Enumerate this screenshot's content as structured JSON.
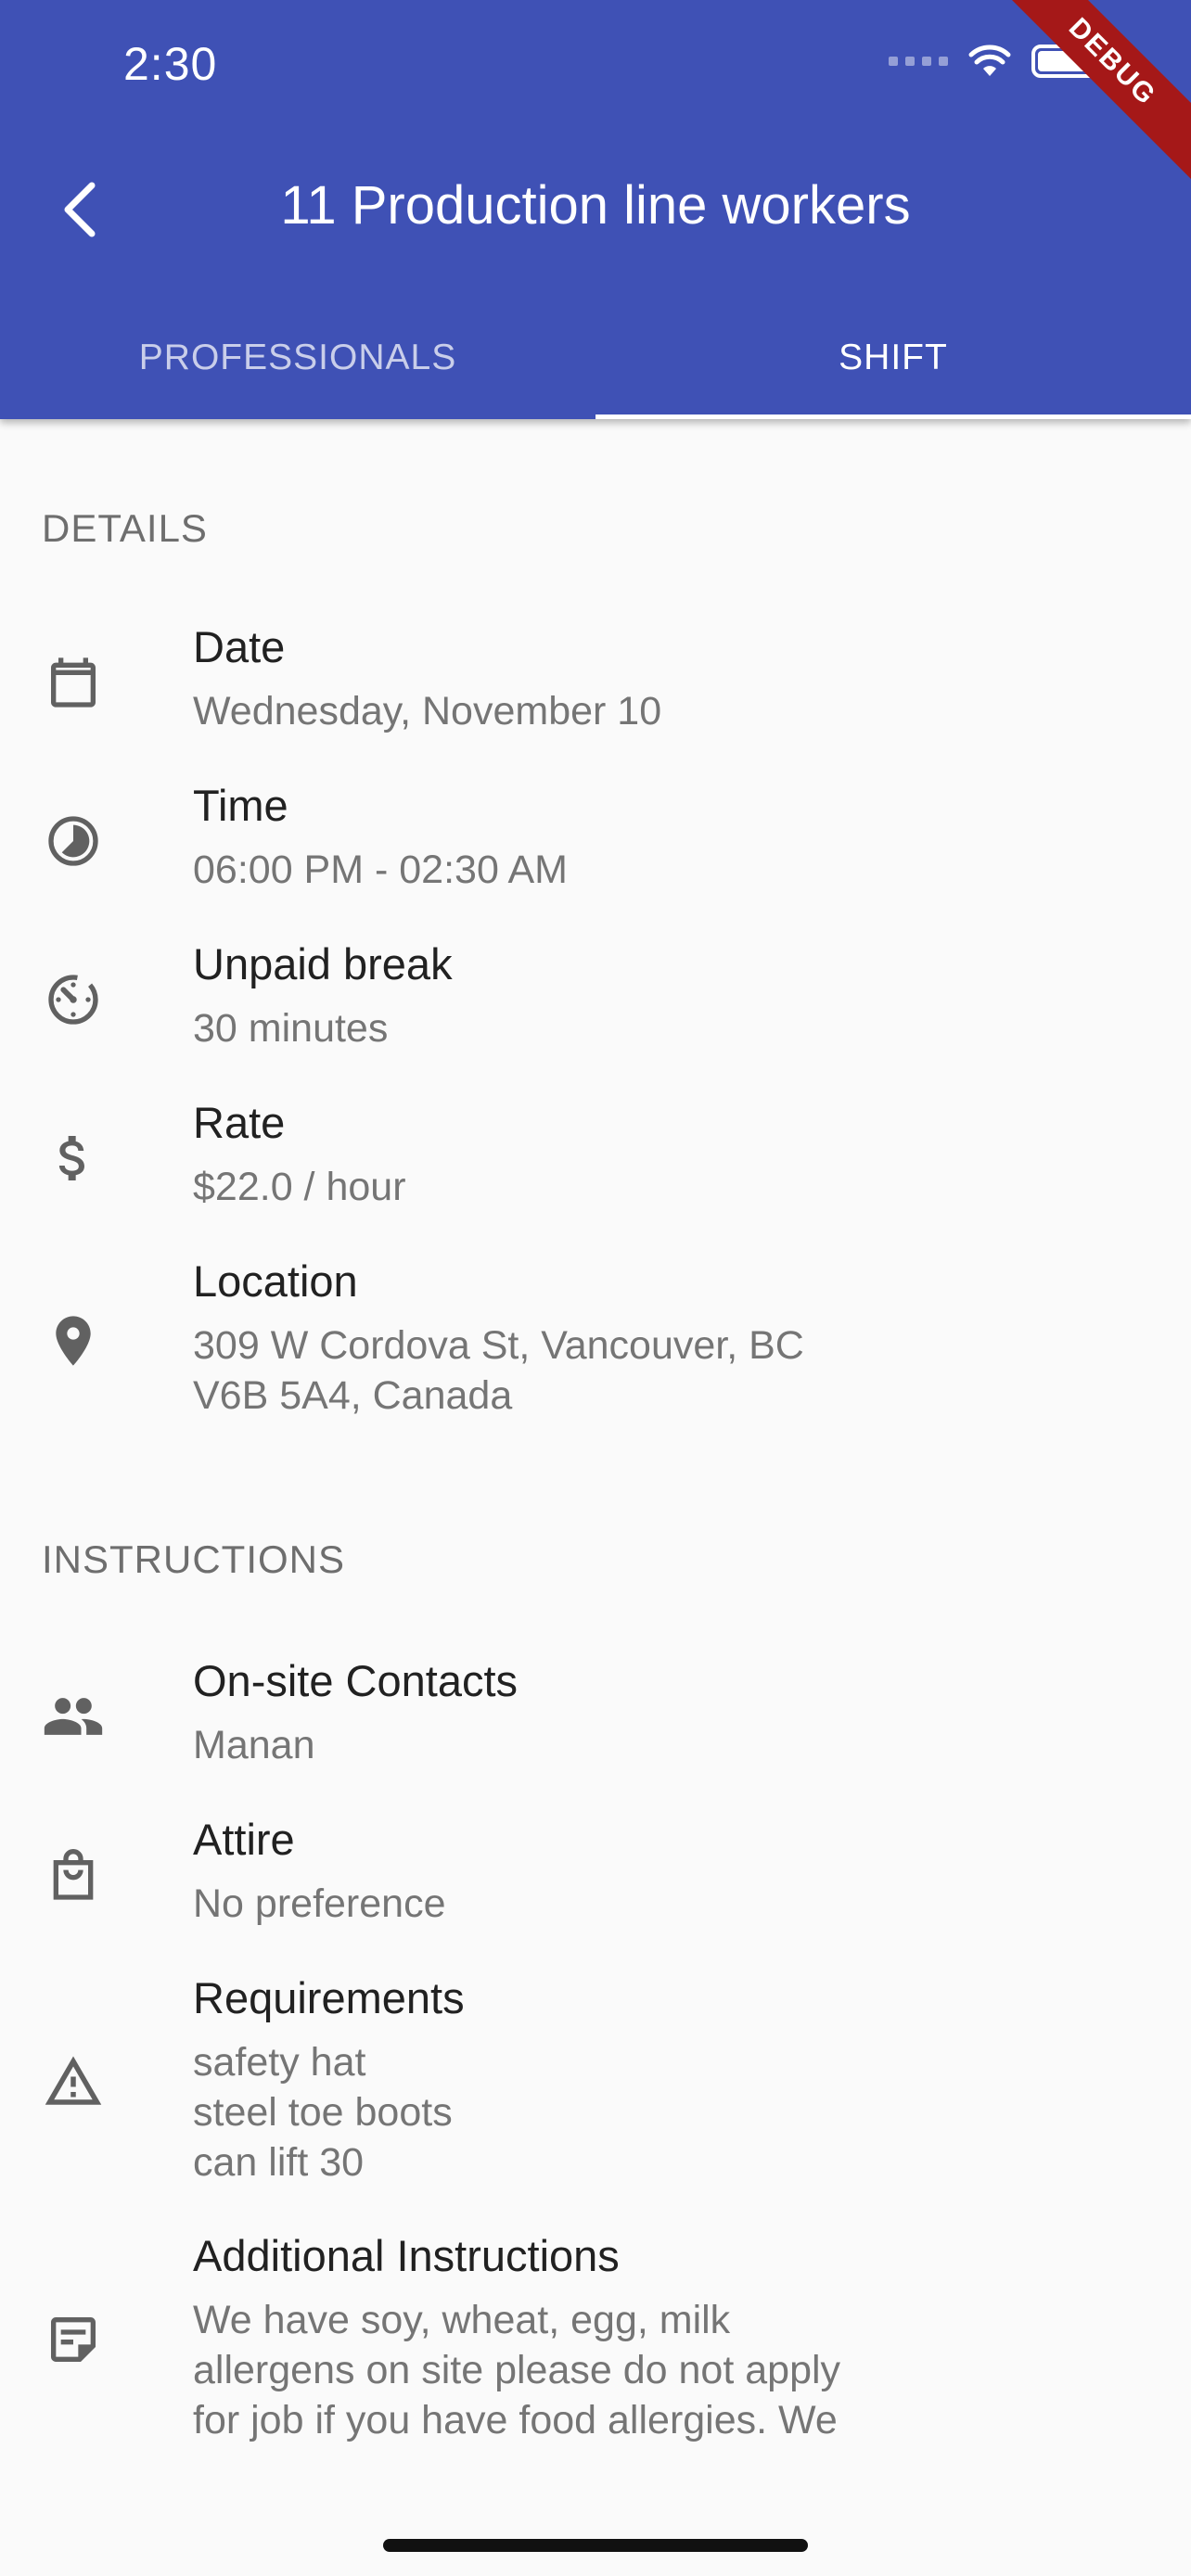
{
  "status_bar": {
    "time": "2:30"
  },
  "debug_banner": "DEBUG",
  "appbar": {
    "title": "11 Production line workers"
  },
  "tabs": [
    {
      "label": "PROFESSIONALS",
      "active": false
    },
    {
      "label": "SHIFT",
      "active": true
    }
  ],
  "details": {
    "header": "DETAILS",
    "items": [
      {
        "icon": "calendar-icon",
        "title": "Date",
        "lines": [
          "Wednesday, November 10"
        ]
      },
      {
        "icon": "clock-icon",
        "title": "Time",
        "lines": [
          "06:00 PM - 02:30 AM"
        ]
      },
      {
        "icon": "timer-icon",
        "title": "Unpaid break",
        "lines": [
          "30 minutes"
        ]
      },
      {
        "icon": "dollar-icon",
        "title": "Rate",
        "lines": [
          "$22.0 / hour"
        ]
      },
      {
        "icon": "location-pin-icon",
        "title": "Location",
        "lines": [
          "309 W Cordova St, Vancouver, BC",
          "V6B 5A4, Canada"
        ]
      }
    ]
  },
  "instructions": {
    "header": "INSTRUCTIONS",
    "items": [
      {
        "icon": "people-icon",
        "title": "On-site Contacts",
        "lines": [
          "Manan"
        ]
      },
      {
        "icon": "shopping-bag-icon",
        "title": "Attire",
        "lines": [
          "No preference"
        ]
      },
      {
        "icon": "warning-icon",
        "title": "Requirements",
        "lines": [
          "safety hat",
          "steel toe boots",
          "can lift 30"
        ]
      },
      {
        "icon": "notes-icon",
        "title": "Additional Instructions",
        "lines": [
          "We have soy, wheat, egg, milk",
          "allergens on site please do not apply",
          "for job if you have food allergies. We"
        ]
      }
    ]
  },
  "colors": {
    "primary": "#3F51B5",
    "background": "#FAFAFA",
    "debug": "#A51818",
    "icon": "#616161"
  }
}
